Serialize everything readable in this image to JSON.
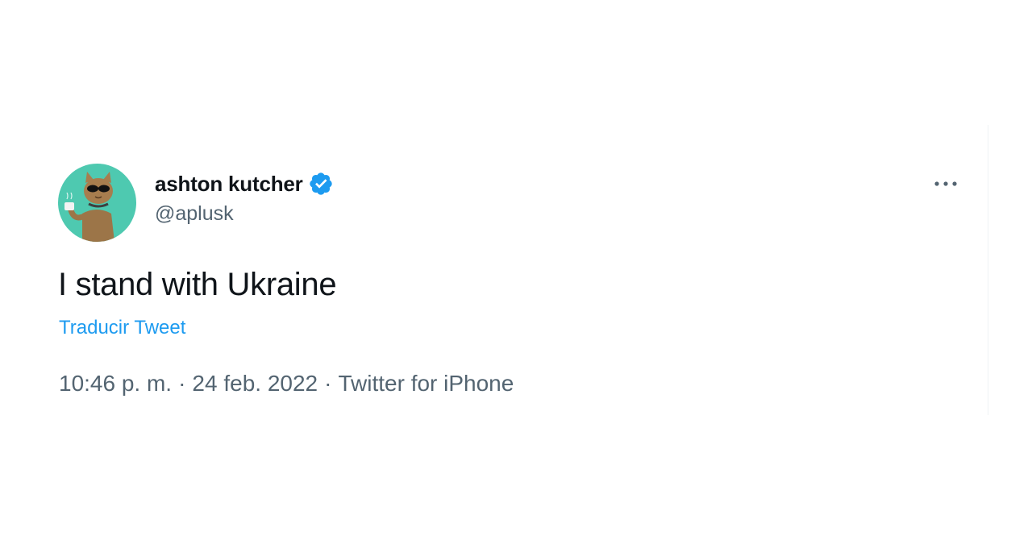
{
  "tweet": {
    "author": {
      "display_name": "ashton kutcher",
      "handle": "@aplusk",
      "verified": true,
      "avatar_icon": "cartoon-cat-sunglasses-avatar"
    },
    "text": "I stand with Ukraine",
    "translate_label": "Traducir Tweet",
    "meta": {
      "time": "10:46 p. m.",
      "date": "24 feb. 2022",
      "source": "Twitter for iPhone",
      "separator": "·"
    },
    "more_icon": "more-horizontal-icon"
  },
  "colors": {
    "text_primary": "#0f1419",
    "text_secondary": "#536471",
    "link": "#1d9bf0",
    "verified_badge": "#1d9bf0",
    "avatar_background": "#4ec9b0"
  }
}
